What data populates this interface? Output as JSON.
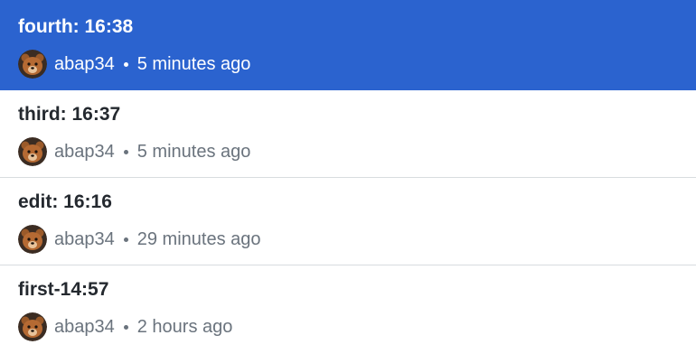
{
  "commits": [
    {
      "title": "fourth: 16:38",
      "author": "abap34",
      "time": "5 minutes ago",
      "avatar_icon": "bear-avatar-icon",
      "selected": true
    },
    {
      "title": "third: 16:37",
      "author": "abap34",
      "time": "5 minutes ago",
      "avatar_icon": "bear-avatar-icon",
      "selected": false
    },
    {
      "title": "edit: 16:16",
      "author": "abap34",
      "time": "29 minutes ago",
      "avatar_icon": "bear-avatar-icon",
      "selected": false
    },
    {
      "title": "first-14:57",
      "author": "abap34",
      "time": "2 hours ago",
      "avatar_icon": "bear-avatar-icon",
      "selected": false
    }
  ],
  "colors": {
    "selected_background": "#2b63cf",
    "title_text": "#24292f",
    "meta_text": "#6a737d",
    "divider": "#d8dcdf"
  }
}
